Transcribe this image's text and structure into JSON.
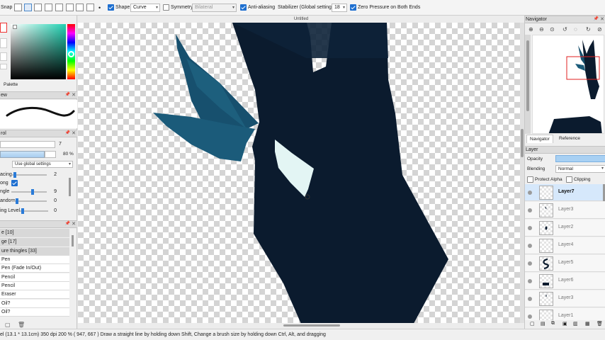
{
  "toolbar": {
    "snap_label": "Snap",
    "shape_label": "Shape",
    "shape_value": "Curve",
    "symmetry_label": "Symmetry",
    "symmetry_value": "Bilateral",
    "antialias_label": "Anti-aliasing",
    "stabilizer_label": "Stabilizer (Global settings)",
    "stabilizer_value": "18",
    "zero_pressure_label": "Zero Pressure on Both Ends"
  },
  "left": {
    "palette_label": "Palette",
    "preview_header": "ew",
    "control_header": "rol",
    "size_value": "7",
    "opacity_value": "80 %",
    "blend_select": "Use global settings",
    "sliders": [
      {
        "label": "acing",
        "value": "2"
      },
      {
        "label": "ong",
        "value": ""
      },
      {
        "label": "ngle",
        "value": "9"
      },
      {
        "label": "andom",
        "value": "0"
      },
      {
        "label": "ing Level",
        "value": "0"
      }
    ],
    "brush_groups": [
      "e [10]",
      "ge [17]",
      "ure thingles [33]"
    ],
    "brushes": [
      "Pen",
      "Pen (Fade In/Out)",
      "Pencil",
      "Pencil",
      "Eraser",
      "Oil?",
      "Oil?"
    ]
  },
  "canvas": {
    "doc_title": "Untitled",
    "colors": {
      "dark": "#0b1b2e",
      "blue": "#17506e",
      "eye": "#e3f5f4"
    }
  },
  "right": {
    "navigator_header": "Navigator",
    "tab_navigator": "Navigator",
    "tab_reference": "Reference",
    "layer_header": "Layer",
    "opacity_label": "Opacity",
    "blending_label": "Blending",
    "blending_value": "Normal",
    "protect_alpha_label": "Protect Alpha",
    "clipping_label": "Clipping",
    "layers": [
      "Layer7",
      "Layer3",
      "Layer2",
      "Layer4",
      "Layer5",
      "Layer6",
      "Layer3",
      "Layer1"
    ]
  },
  "status": {
    "text": "el  (13.1 * 13.1cm)   350 dpi   200 %   ( 947, 667 )   Draw a straight line by holding down Shift, Change a brush size by holding down Ctrl, Alt, and dragging"
  }
}
